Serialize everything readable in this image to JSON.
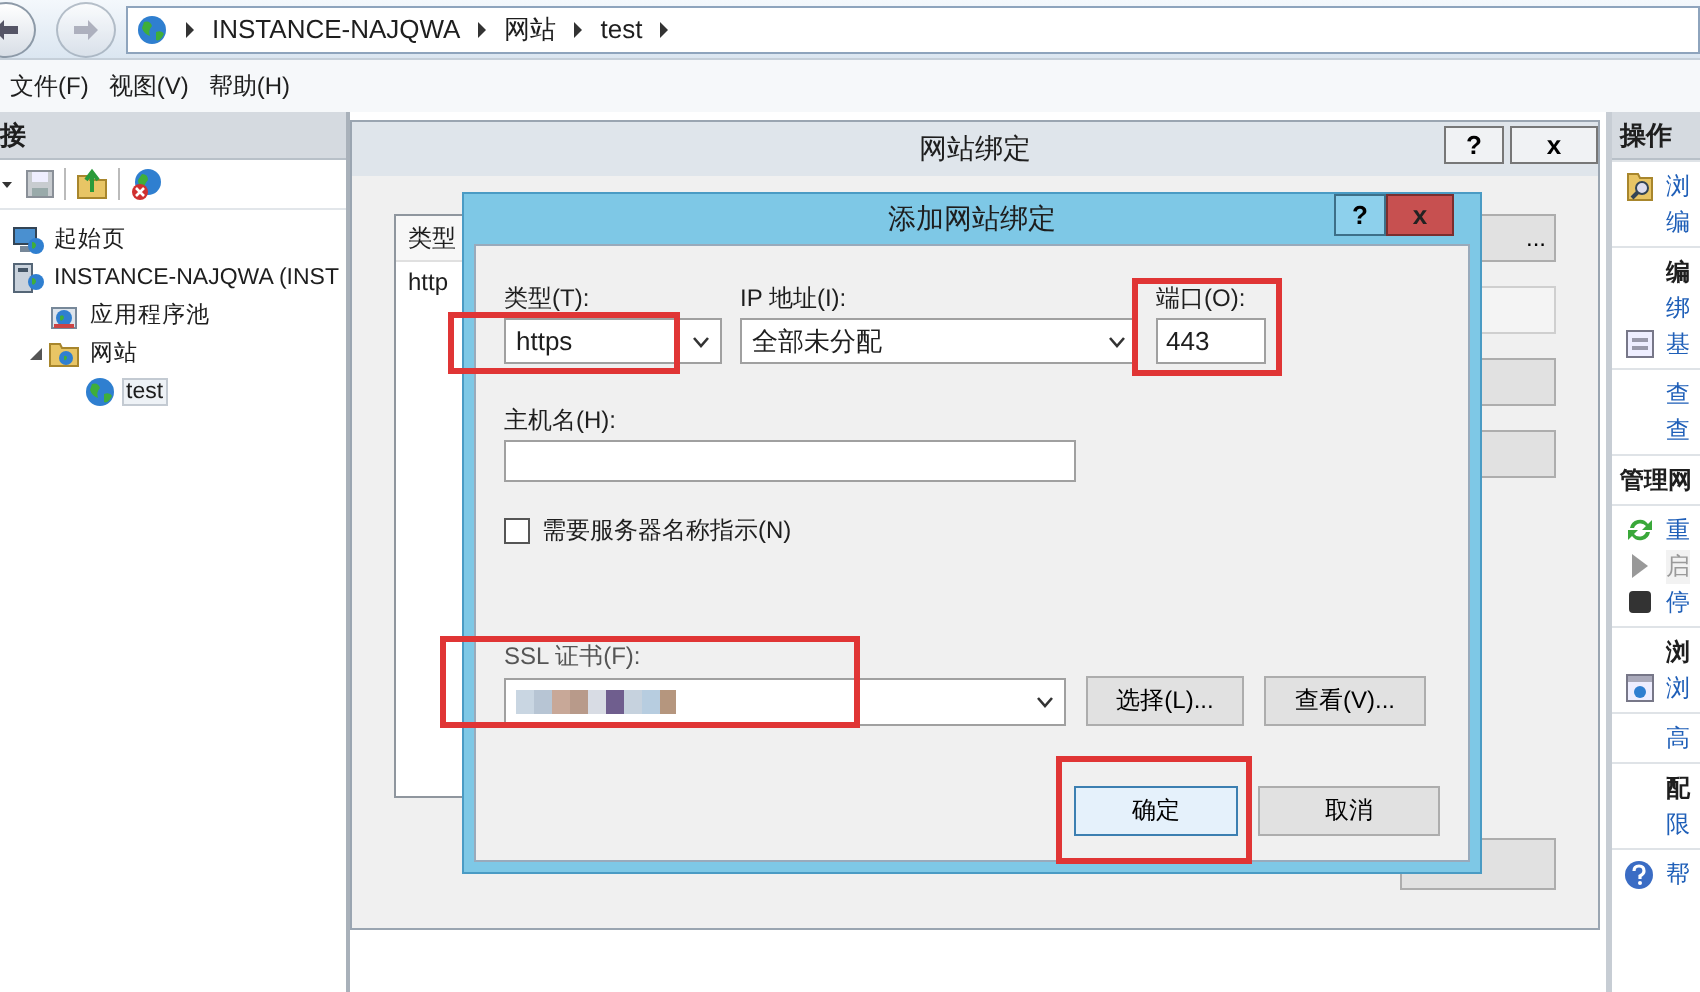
{
  "address_bar": {
    "breadcrumb": [
      "INSTANCE-NAJQWA",
      "网站",
      "test"
    ]
  },
  "menu": [
    "文件(F)",
    "视图(V)",
    "帮助(H)"
  ],
  "connections": {
    "title": "接",
    "tree": [
      {
        "label": "起始页",
        "kind": "start-page",
        "selected": false
      },
      {
        "label": "INSTANCE-NAJQWA (INST",
        "kind": "server",
        "selected": false,
        "children": [
          {
            "label": "应用程序池",
            "kind": "app-pools",
            "selected": false,
            "expanded": false
          },
          {
            "label": "网站",
            "kind": "sites",
            "selected": false,
            "expanded": true,
            "children": [
              {
                "label": "test",
                "kind": "site",
                "selected": true
              }
            ]
          }
        ]
      }
    ]
  },
  "bindings_dialog": {
    "title": "网站绑定",
    "help": "?",
    "close": "x",
    "columns": [
      "类型"
    ],
    "rows": [
      [
        "http"
      ]
    ],
    "buttons": [
      {
        "label": "...",
        "disabled": false
      },
      {
        "disabled": true
      },
      {
        "disabled": false
      },
      {
        "disabled": false
      }
    ]
  },
  "add_binding_dialog": {
    "title": "添加网站绑定",
    "help": "?",
    "close": "x",
    "type": {
      "label": "类型(T):",
      "value": "https"
    },
    "ip": {
      "label": "IP 地址(I):",
      "value": "全部未分配"
    },
    "port": {
      "label": "端口(O):",
      "value": "443"
    },
    "hostname": {
      "label": "主机名(H):"
    },
    "sni": {
      "label": "需要服务器名称指示(N)",
      "checked": false
    },
    "ssl": {
      "label": "SSL 证书(F):"
    },
    "select_button": "选择(L)...",
    "view_button": "查看(V)...",
    "ok": "确定",
    "cancel": "取消"
  },
  "actions": {
    "title": "操作",
    "groups": [
      [
        {
          "kind": "link",
          "label": "浏",
          "disabled": false
        },
        {
          "kind": "link",
          "label": "编",
          "disabled": false
        }
      ],
      [
        {
          "kind": "heading",
          "label": "编"
        },
        {
          "kind": "link",
          "label": "绑",
          "disabled": false
        },
        {
          "kind": "link",
          "label": "基",
          "disabled": false
        }
      ],
      [
        {
          "kind": "link",
          "label": "查",
          "disabled": false
        },
        {
          "kind": "link",
          "label": "查",
          "disabled": false
        }
      ],
      [
        {
          "kind": "section",
          "label": "管理网"
        }
      ],
      [
        {
          "kind": "link",
          "label": "重",
          "disabled": false
        },
        {
          "kind": "link",
          "label": "启",
          "disabled": true
        },
        {
          "kind": "link",
          "label": "停",
          "disabled": false
        }
      ],
      [
        {
          "kind": "heading",
          "label": "浏"
        },
        {
          "kind": "link",
          "label": "浏",
          "disabled": false
        }
      ],
      [
        {
          "kind": "link",
          "label": "高",
          "disabled": false
        }
      ],
      [
        {
          "kind": "heading",
          "label": "配"
        },
        {
          "kind": "link",
          "label": "限",
          "disabled": false
        }
      ],
      [
        {
          "kind": "link",
          "label": "帮",
          "disabled": false
        }
      ]
    ]
  }
}
